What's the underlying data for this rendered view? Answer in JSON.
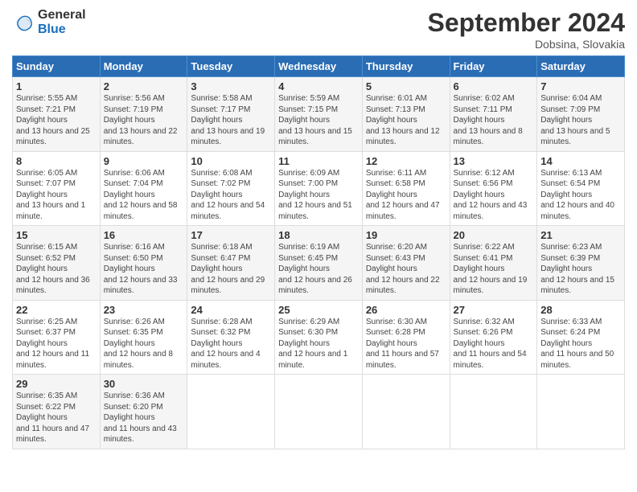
{
  "header": {
    "logo_line1": "General",
    "logo_line2": "Blue",
    "month_title": "September 2024",
    "subtitle": "Dobsina, Slovakia"
  },
  "days_of_week": [
    "Sunday",
    "Monday",
    "Tuesday",
    "Wednesday",
    "Thursday",
    "Friday",
    "Saturday"
  ],
  "weeks": [
    [
      {
        "day": "1",
        "sunrise": "5:55 AM",
        "sunset": "7:21 PM",
        "daylight": "13 hours and 25 minutes."
      },
      {
        "day": "2",
        "sunrise": "5:56 AM",
        "sunset": "7:19 PM",
        "daylight": "13 hours and 22 minutes."
      },
      {
        "day": "3",
        "sunrise": "5:58 AM",
        "sunset": "7:17 PM",
        "daylight": "13 hours and 19 minutes."
      },
      {
        "day": "4",
        "sunrise": "5:59 AM",
        "sunset": "7:15 PM",
        "daylight": "13 hours and 15 minutes."
      },
      {
        "day": "5",
        "sunrise": "6:01 AM",
        "sunset": "7:13 PM",
        "daylight": "13 hours and 12 minutes."
      },
      {
        "day": "6",
        "sunrise": "6:02 AM",
        "sunset": "7:11 PM",
        "daylight": "13 hours and 8 minutes."
      },
      {
        "day": "7",
        "sunrise": "6:04 AM",
        "sunset": "7:09 PM",
        "daylight": "13 hours and 5 minutes."
      }
    ],
    [
      {
        "day": "8",
        "sunrise": "6:05 AM",
        "sunset": "7:07 PM",
        "daylight": "13 hours and 1 minute."
      },
      {
        "day": "9",
        "sunrise": "6:06 AM",
        "sunset": "7:04 PM",
        "daylight": "12 hours and 58 minutes."
      },
      {
        "day": "10",
        "sunrise": "6:08 AM",
        "sunset": "7:02 PM",
        "daylight": "12 hours and 54 minutes."
      },
      {
        "day": "11",
        "sunrise": "6:09 AM",
        "sunset": "7:00 PM",
        "daylight": "12 hours and 51 minutes."
      },
      {
        "day": "12",
        "sunrise": "6:11 AM",
        "sunset": "6:58 PM",
        "daylight": "12 hours and 47 minutes."
      },
      {
        "day": "13",
        "sunrise": "6:12 AM",
        "sunset": "6:56 PM",
        "daylight": "12 hours and 43 minutes."
      },
      {
        "day": "14",
        "sunrise": "6:13 AM",
        "sunset": "6:54 PM",
        "daylight": "12 hours and 40 minutes."
      }
    ],
    [
      {
        "day": "15",
        "sunrise": "6:15 AM",
        "sunset": "6:52 PM",
        "daylight": "12 hours and 36 minutes."
      },
      {
        "day": "16",
        "sunrise": "6:16 AM",
        "sunset": "6:50 PM",
        "daylight": "12 hours and 33 minutes."
      },
      {
        "day": "17",
        "sunrise": "6:18 AM",
        "sunset": "6:47 PM",
        "daylight": "12 hours and 29 minutes."
      },
      {
        "day": "18",
        "sunrise": "6:19 AM",
        "sunset": "6:45 PM",
        "daylight": "12 hours and 26 minutes."
      },
      {
        "day": "19",
        "sunrise": "6:20 AM",
        "sunset": "6:43 PM",
        "daylight": "12 hours and 22 minutes."
      },
      {
        "day": "20",
        "sunrise": "6:22 AM",
        "sunset": "6:41 PM",
        "daylight": "12 hours and 19 minutes."
      },
      {
        "day": "21",
        "sunrise": "6:23 AM",
        "sunset": "6:39 PM",
        "daylight": "12 hours and 15 minutes."
      }
    ],
    [
      {
        "day": "22",
        "sunrise": "6:25 AM",
        "sunset": "6:37 PM",
        "daylight": "12 hours and 11 minutes."
      },
      {
        "day": "23",
        "sunrise": "6:26 AM",
        "sunset": "6:35 PM",
        "daylight": "12 hours and 8 minutes."
      },
      {
        "day": "24",
        "sunrise": "6:28 AM",
        "sunset": "6:32 PM",
        "daylight": "12 hours and 4 minutes."
      },
      {
        "day": "25",
        "sunrise": "6:29 AM",
        "sunset": "6:30 PM",
        "daylight": "12 hours and 1 minute."
      },
      {
        "day": "26",
        "sunrise": "6:30 AM",
        "sunset": "6:28 PM",
        "daylight": "11 hours and 57 minutes."
      },
      {
        "day": "27",
        "sunrise": "6:32 AM",
        "sunset": "6:26 PM",
        "daylight": "11 hours and 54 minutes."
      },
      {
        "day": "28",
        "sunrise": "6:33 AM",
        "sunset": "6:24 PM",
        "daylight": "11 hours and 50 minutes."
      }
    ],
    [
      {
        "day": "29",
        "sunrise": "6:35 AM",
        "sunset": "6:22 PM",
        "daylight": "11 hours and 47 minutes."
      },
      {
        "day": "30",
        "sunrise": "6:36 AM",
        "sunset": "6:20 PM",
        "daylight": "11 hours and 43 minutes."
      },
      null,
      null,
      null,
      null,
      null
    ]
  ]
}
